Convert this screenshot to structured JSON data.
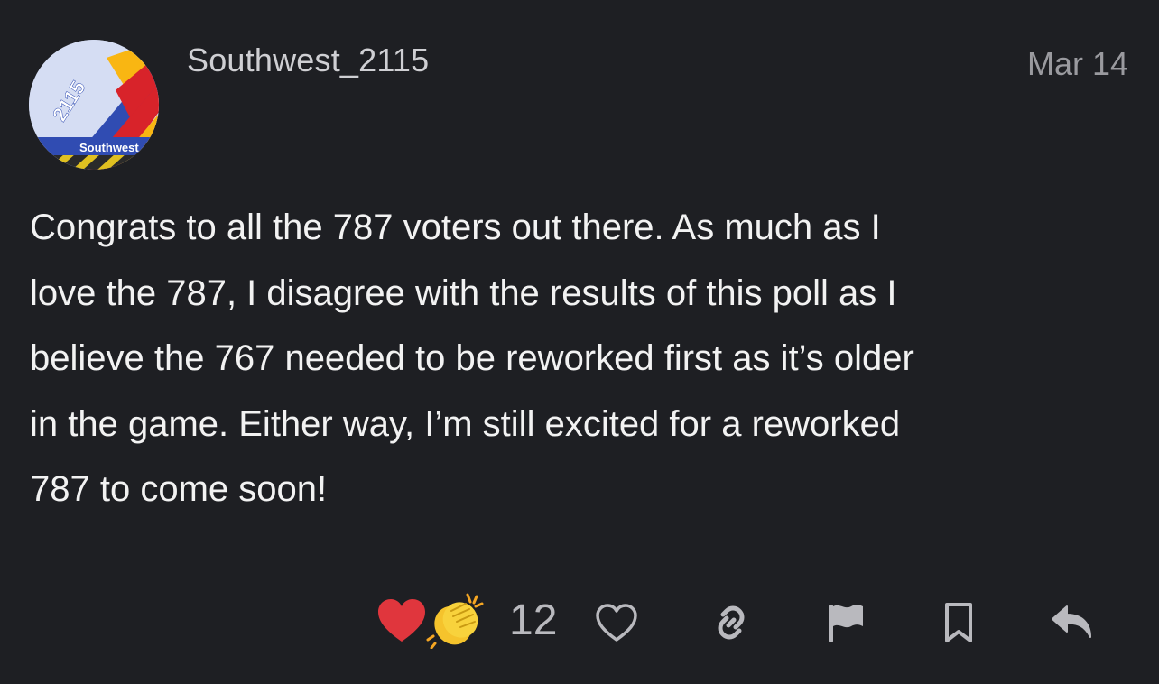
{
  "post": {
    "username": "Southwest_2115",
    "date": "Mar 14",
    "avatar": {
      "number": "2115",
      "brand": "Southwest",
      "colors": {
        "sky": "#d5ddf3",
        "tail_red": "#d8232a",
        "tail_yellow": "#f9b612",
        "tail_blue": "#304cb2",
        "label_bg": "#304cb2"
      }
    },
    "body": [
      "Congrats to all the 787 voters out there. As much as I",
      "love the 787, I disagree with the results of this poll as I",
      "believe the 767 needed to be reworked first as it’s older",
      "in the game. Either way, I’m still excited for a reworked",
      "787 to come soon!"
    ],
    "reactions": {
      "icons": [
        "heart-icon",
        "clapping-hands-icon"
      ],
      "count": "12"
    },
    "actions": [
      {
        "name": "like-button",
        "icon": "heart-outline-icon"
      },
      {
        "name": "copy-link-button",
        "icon": "link-icon"
      },
      {
        "name": "flag-button",
        "icon": "flag-icon"
      },
      {
        "name": "bookmark-button",
        "icon": "bookmark-icon"
      },
      {
        "name": "reply-button",
        "icon": "reply-icon"
      }
    ],
    "colors": {
      "background": "#1e1f23",
      "text": "#f2f2f2",
      "muted": "#9a9a9f",
      "icon": "#b9b9be",
      "heart_red": "#e0363d",
      "clap_yellow": "#f5c32c"
    }
  }
}
